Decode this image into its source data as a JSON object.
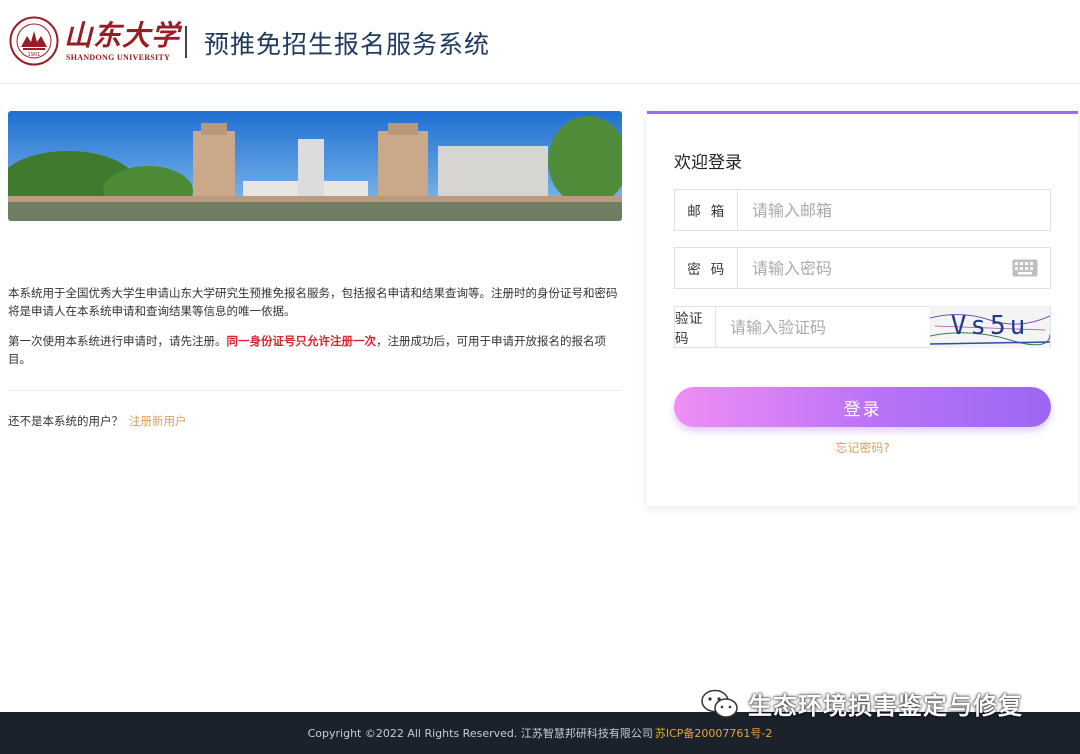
{
  "header": {
    "logo_cn": "山东大学",
    "logo_en": "SHANDONG UNIVERSITY",
    "logo_seal_year": "1901",
    "system_title": "预推免招生报名服务系统"
  },
  "intro": {
    "paragraph1": "本系统用于全国优秀大学生申请山东大学研究生预推免报名服务，包括报名申请和结果查询等。注册时的身份证号和密码将是申请人在本系统申请和查询结果等信息的唯一依据。",
    "paragraph2_before": "第一次使用本系统进行申请时，请先注册。",
    "paragraph2_warning": "同一身份证号只允许注册一次",
    "paragraph2_after": "，注册成功后，可用于申请开放报名的报名项目。",
    "not_user_text": "还不是本系统的用户？",
    "register_link": "注册新用户"
  },
  "login": {
    "title": "欢迎登录",
    "email_label": "邮  箱",
    "email_placeholder": "请输入邮箱",
    "password_label": "密  码",
    "password_placeholder": "请输入密码",
    "captcha_label": "验证码",
    "captcha_placeholder": "请输入验证码",
    "captcha_text": "Vs5u",
    "submit_label": "登录",
    "forgot_label": "忘记密码?"
  },
  "footer": {
    "copyright": "Copyright ©2022 All Rights Reserved. 江苏智慧邦研科技有限公司",
    "icp": "苏ICP备20007761号-2"
  },
  "watermark": {
    "text": "生态环境损害鉴定与修复"
  },
  "colors": {
    "brand_red": "#9b1c23",
    "accent_purple": "#9a6cf0",
    "link_gold": "#d9a05a",
    "warning_red": "#d7262f",
    "footer_bg": "#1b222c"
  },
  "icons": [
    "university-seal-icon",
    "keyboard-icon",
    "wechat-icon"
  ]
}
